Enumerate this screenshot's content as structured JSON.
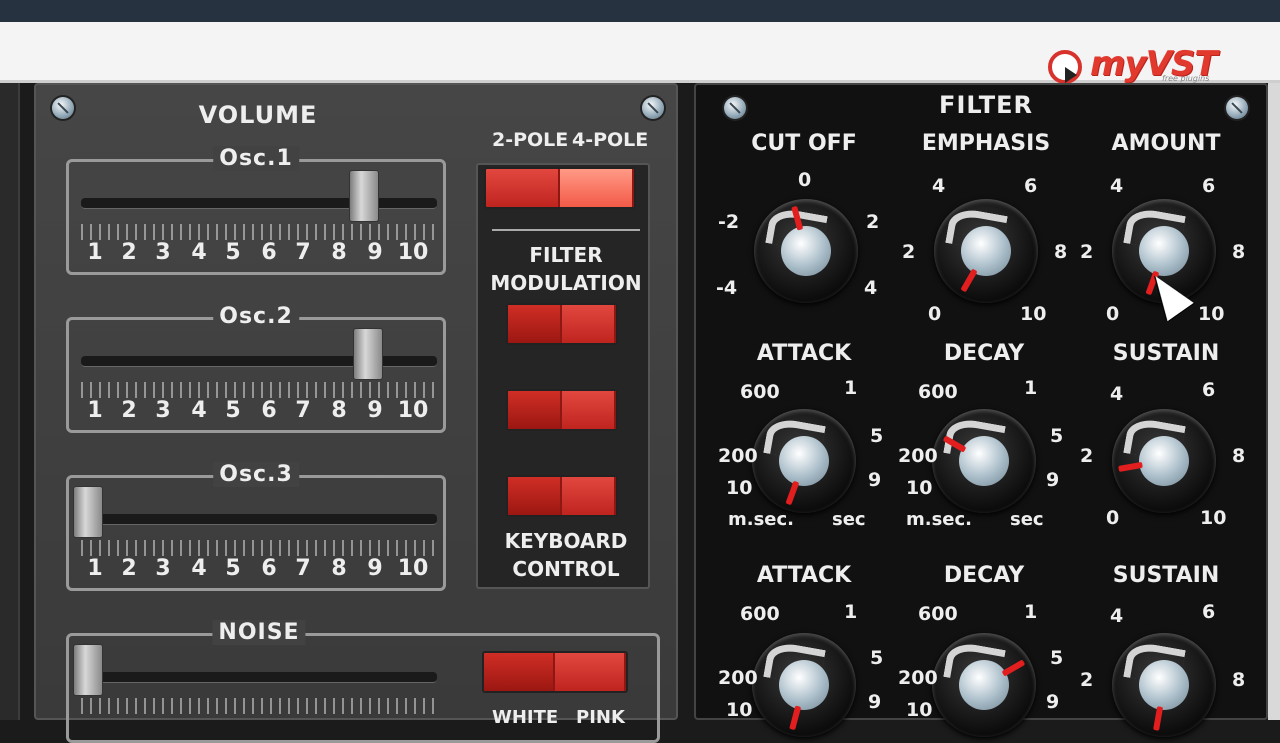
{
  "header": {
    "logo_text": "myVST",
    "logo_subtitle": "free plugins"
  },
  "volume_section": {
    "title": "VOLUME",
    "sliders": [
      {
        "name": "Osc.1",
        "value": 8.6,
        "scale": [
          "1",
          "2",
          "3",
          "4",
          "5",
          "6",
          "7",
          "8",
          "9",
          "10"
        ]
      },
      {
        "name": "Osc.2",
        "value": 8.6,
        "scale": [
          "1",
          "2",
          "3",
          "4",
          "5",
          "6",
          "7",
          "8",
          "9",
          "10"
        ]
      },
      {
        "name": "Osc.3",
        "value": 1.0,
        "scale": [
          "1",
          "2",
          "3",
          "4",
          "5",
          "6",
          "7",
          "8",
          "9",
          "10"
        ]
      }
    ],
    "noise": {
      "name": "NOISE",
      "value": 1.0
    }
  },
  "switch_column": {
    "pole_left": "2-POLE",
    "pole_right": "4-POLE",
    "filter_mod_line1": "FILTER",
    "filter_mod_line2": "MODULATION",
    "keyboard_line1": "KEYBOARD",
    "keyboard_line2": "CONTROL",
    "noise_left": "WHITE",
    "noise_right": "PINK"
  },
  "filter_section": {
    "title": "FILTER",
    "row1": [
      {
        "label": "CUT OFF",
        "scale": [
          "0",
          "-2",
          "2",
          "-4",
          "4"
        ],
        "value": -0.3
      },
      {
        "label": "EMPHASIS",
        "scale": [
          "4",
          "6",
          "2",
          "8",
          "0",
          "10"
        ],
        "value": 1.2
      },
      {
        "label": "AMOUNT",
        "scale": [
          "4",
          "6",
          "2",
          "8",
          "0",
          "10"
        ],
        "value": 0.6
      }
    ],
    "row2": [
      {
        "label": "ATTACK",
        "scale": [
          "600",
          "1",
          "200",
          "5",
          "10",
          "9"
        ],
        "unit_left": "m.sec.",
        "unit_right": "sec",
        "value": 10
      },
      {
        "label": "DECAY",
        "scale": [
          "600",
          "1",
          "200",
          "5",
          "10",
          "9"
        ],
        "unit_left": "m.sec.",
        "unit_right": "sec",
        "value": 400
      },
      {
        "label": "SUSTAIN",
        "scale": [
          "4",
          "6",
          "2",
          "8",
          "0",
          "10"
        ],
        "value": 2.2
      }
    ],
    "row3": [
      {
        "label": "ATTACK",
        "scale": [
          "600",
          "1",
          "200",
          "5",
          "10",
          "9"
        ],
        "value": 10
      },
      {
        "label": "DECAY",
        "scale": [
          "600",
          "1",
          "200",
          "5",
          "10",
          "9"
        ],
        "value": 3
      },
      {
        "label": "SUSTAIN",
        "scale": [
          "4",
          "6",
          "2",
          "8"
        ],
        "value": 0.6
      }
    ]
  }
}
